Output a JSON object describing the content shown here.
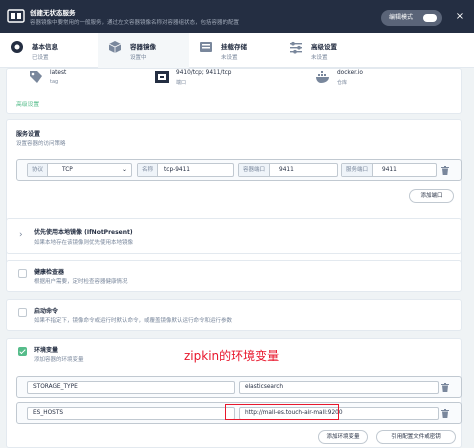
{
  "header": {
    "title": "创建无状态服务",
    "subtitle": "容器镜像中要常用的一般服务，通过左文容器镜像名称对容器组状态，包括容器的配置",
    "edit_mode_label": "编辑模式",
    "close_label": "×"
  },
  "steps": [
    {
      "name": "基本信息",
      "status": "已设置"
    },
    {
      "name": "容器镜像",
      "status": "设置中"
    },
    {
      "name": "挂载存储",
      "status": "未设置"
    },
    {
      "name": "高级设置",
      "status": "未设置"
    }
  ],
  "container": {
    "tag_value": "latest",
    "tag_label": "tag",
    "ports_value": "9410/tcp; 9411/tcp",
    "ports_label": "端口",
    "repo_value": "docker.io",
    "repo_label": "仓库",
    "advanced_link": "高级设置"
  },
  "service": {
    "title": "服务设置",
    "desc": "设置容器的访问策略",
    "protocol_label": "协议",
    "protocol_value": "TCP",
    "name_label": "名称",
    "name_value": "tcp-9411",
    "container_port_label": "容器端口",
    "container_port_value": "9411",
    "service_port_label": "服务端口",
    "service_port_value": "9411",
    "add_port_label": "添加端口"
  },
  "pull_policy": {
    "title": "优先使用本地镜像 (IfNotPresent)",
    "desc": "如果本地存在该镜像则优先使用本地镜像"
  },
  "health": {
    "title": "健康检查器",
    "desc": "根据用户需要，定时检查容器健康情况"
  },
  "startup": {
    "title": "启动命令",
    "desc": "如果不指定下，镜像命令或运行时默认命令，或覆盖镜像默认运行命令和运行参数"
  },
  "env": {
    "title": "环境变量",
    "desc": "添加容器的环境变量",
    "rows": [
      {
        "key": "STORAGE_TYPE",
        "value": "elasticsearch"
      },
      {
        "key": "ES_HOSTS",
        "value": "http://mall-es.touch-air-mall:9200"
      }
    ],
    "add_label": "添加环境变量",
    "ref_label": "引用配置文件或密钥"
  },
  "annotation": "zipkin的环境变量",
  "colors": {
    "accent": "#55bc8a",
    "header": "#242e42",
    "annotation": "#e8172c"
  }
}
